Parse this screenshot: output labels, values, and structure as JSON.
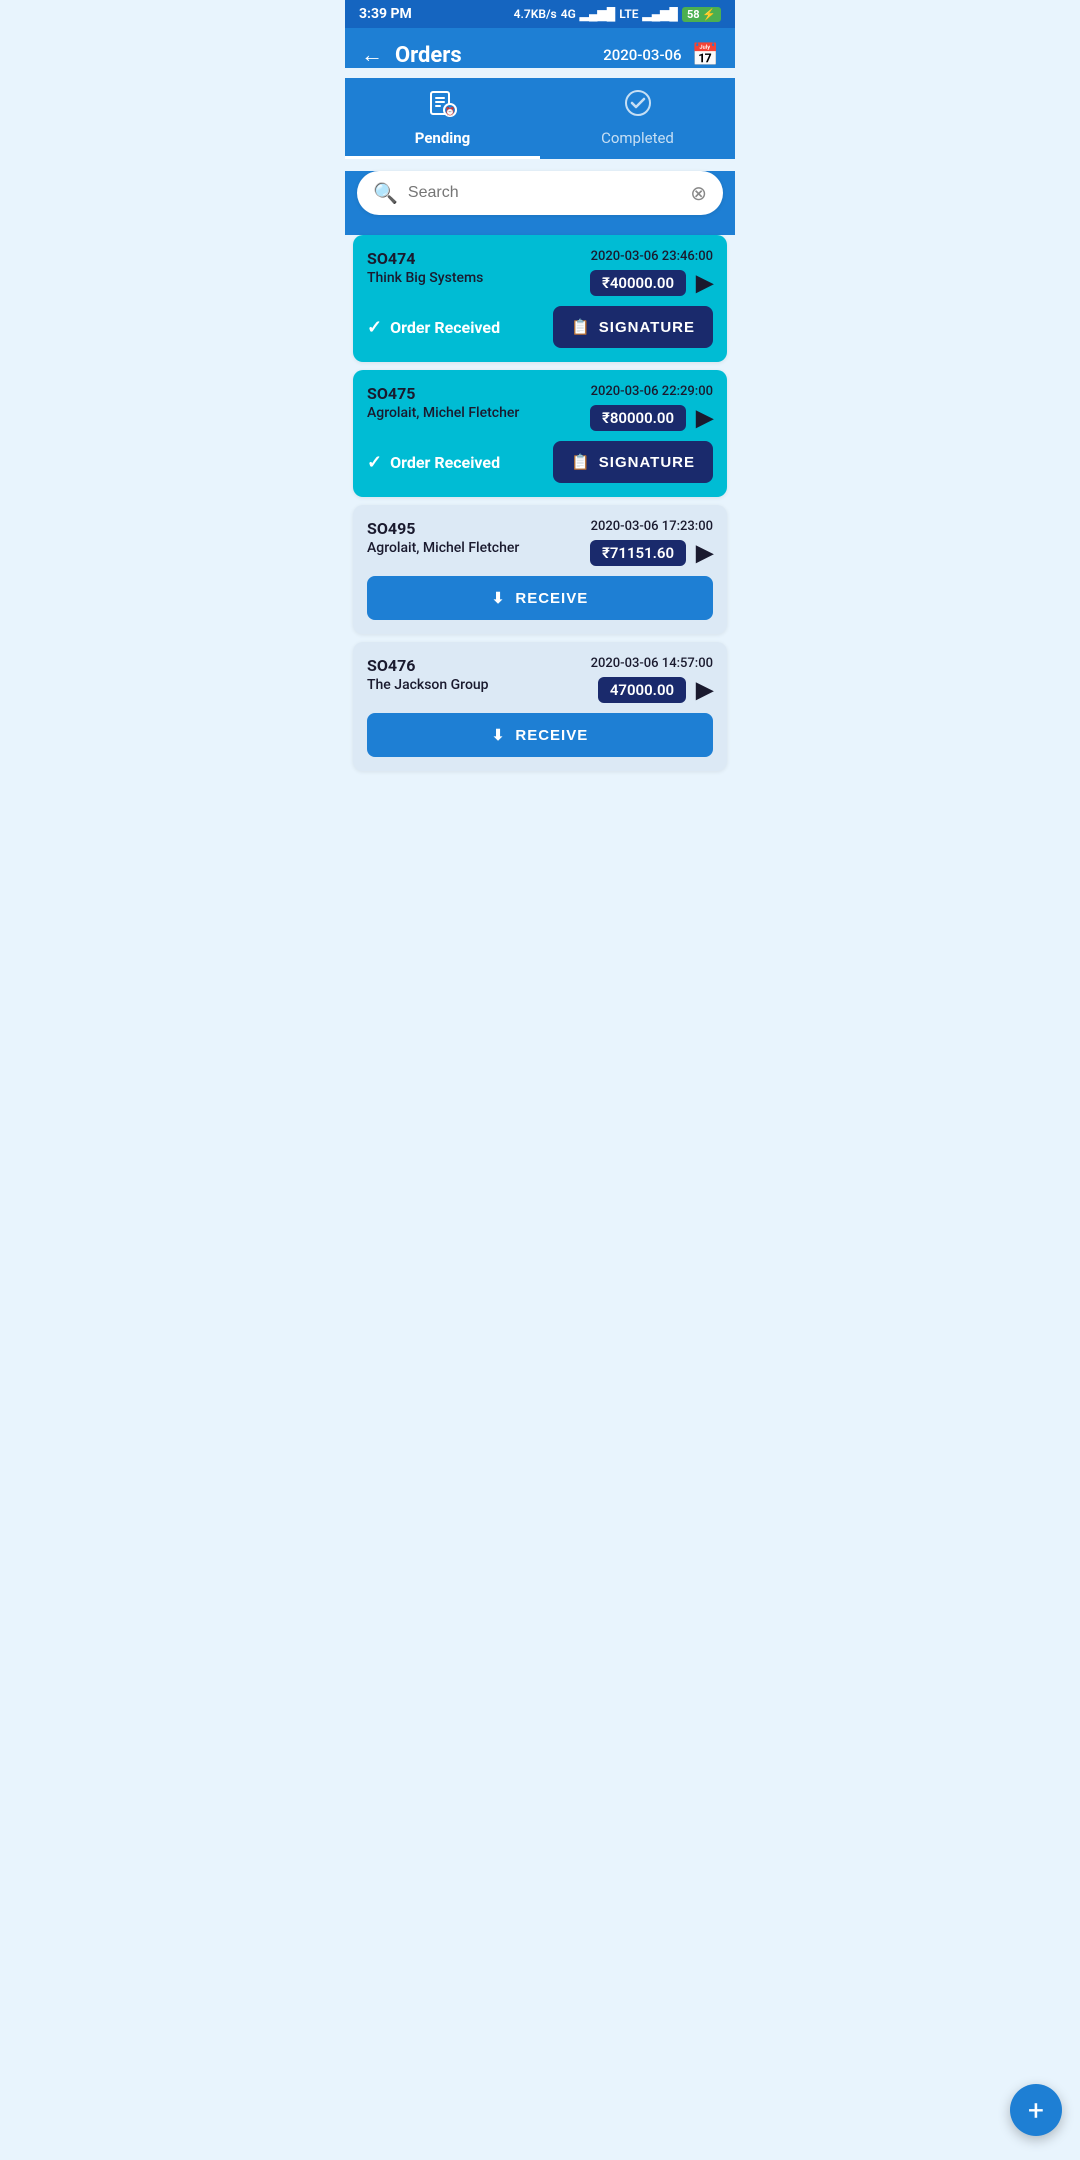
{
  "statusBar": {
    "time": "3:39 PM",
    "network": "4.7KB/s",
    "signal": "4G",
    "battery": "58"
  },
  "header": {
    "title": "Orders",
    "date": "2020-03-06",
    "back_label": "←"
  },
  "tabs": [
    {
      "id": "pending",
      "label": "Pending",
      "active": true
    },
    {
      "id": "completed",
      "label": "Completed",
      "active": false
    }
  ],
  "search": {
    "placeholder": "Search"
  },
  "orders": [
    {
      "id": "SO474",
      "company": "Think Big Systems",
      "datetime": "2020-03-06 23:46:00",
      "amount": "₹40000.00",
      "status": "Order Received",
      "type": "received",
      "action": "SIGNATURE"
    },
    {
      "id": "SO475",
      "company": "Agrolait, Michel Fletcher",
      "datetime": "2020-03-06 22:29:00",
      "amount": "₹80000.00",
      "status": "Order Received",
      "type": "received",
      "action": "SIGNATURE"
    },
    {
      "id": "SO495",
      "company": "Agrolait, Michel Fletcher",
      "datetime": "2020-03-06 17:23:00",
      "amount": "₹71151.60",
      "status": null,
      "type": "pending",
      "action": "RECEIVE"
    },
    {
      "id": "SO476",
      "company": "The Jackson Group",
      "datetime": "2020-03-06 14:57:00",
      "amount": "47000.00",
      "status": null,
      "type": "pending",
      "action": "RECEIVE"
    }
  ],
  "fab": {
    "label": "+"
  },
  "icons": {
    "back": "←",
    "calendar": "📅",
    "search": "🔍",
    "clear": "⊗",
    "arrow": "▶",
    "checkmark": "✓",
    "signature": "📋",
    "receive": "⬇",
    "pending_tab": "📋",
    "completed_tab": "✓"
  }
}
